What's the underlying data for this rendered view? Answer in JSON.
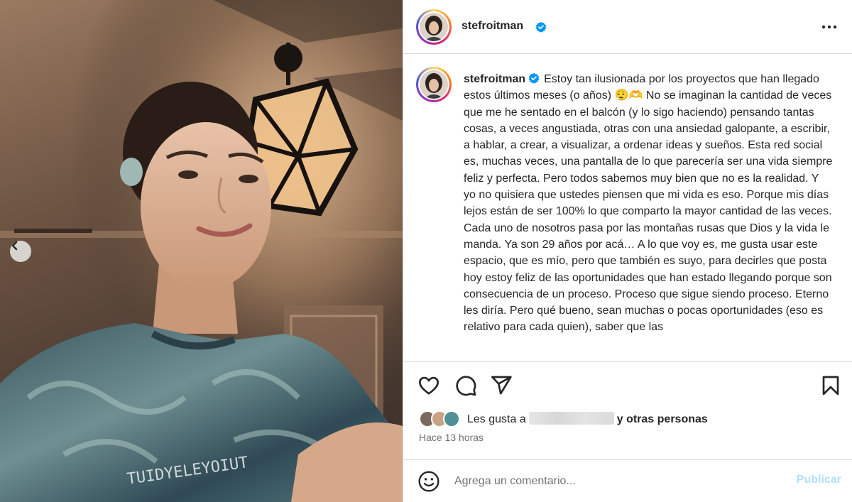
{
  "post": {
    "username": "stefroitman",
    "caption": "Estoy tan ilusionada por los proyectos que han llegado estos últimos meses (o años) 😮‍💨🫶 No se imaginan la cantidad de veces que me he sentado en el balcón (y lo sigo haciendo) pensando tantas cosas, a veces angustiada, otras con una ansiedad galopante, a escribir, a hablar, a crear, a visualizar, a ordenar ideas y sueños. Esta red social es, muchas veces, una pantalla de lo que parecería ser una vida siempre feliz y perfecta. Pero todos sabemos muy bien que no es la realidad. Y yo no quisiera que ustedes piensen que mi vida es eso. Porque mis días lejos están de ser 100% lo que comparto la mayor cantidad de las veces. Cada uno de nosotros pasa por las montañas rusas que Dios y la vida le manda. Ya son 29 años por acá… A lo que voy es, me gusta usar este espacio, que es mío, pero que también es suyo, para decirles que posta hoy estoy feliz de las oportunidades que han estado llegando porque son consecuencia de un proceso. Proceso que sigue siendo proceso. Eterno les diría. Pero qué bueno, sean muchas o pocas oportunidades (eso es relativo para cada quien), saber que las",
    "likes_prefix": "Les gusta a",
    "likes_suffix": "y otras personas",
    "timestamp": "Hace 13 horas"
  },
  "comment": {
    "placeholder": "Agrega un comentario...",
    "publish_label": "Publicar"
  },
  "photo": {
    "shirt_text": "TUIDYELEYOIUT"
  },
  "colors": {
    "verified": "#0095f6",
    "publish_disabled": "#b2dffc",
    "border": "#dbdbdb",
    "muted": "#737373"
  },
  "icons": [
    "chevron-left-icon",
    "verified-badge-icon",
    "more-options-icon",
    "heart-icon",
    "comment-icon",
    "share-icon",
    "bookmark-icon",
    "emoji-icon"
  ]
}
